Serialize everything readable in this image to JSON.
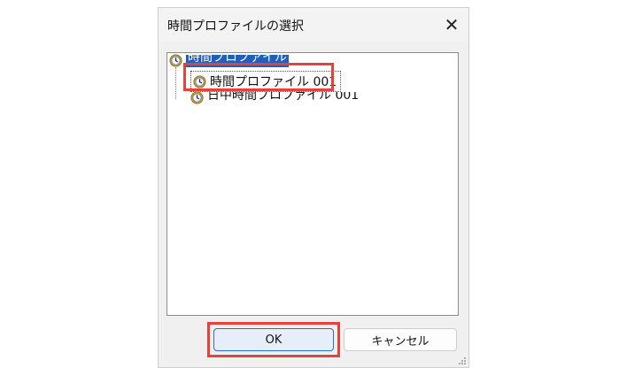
{
  "dialog": {
    "title": "時間プロファイルの選択",
    "close_symbol": "✕"
  },
  "tree": {
    "root_label": "時間プロファイル",
    "items": [
      {
        "label": "時間プロファイル 001"
      },
      {
        "label": "日中時間プロファイル 001"
      }
    ]
  },
  "buttons": {
    "ok_label": "OK",
    "cancel_label": "キャンセル"
  },
  "colors": {
    "highlight": "#e8403a",
    "selection": "#1f5fbf",
    "ok_border": "#2a6bd6"
  }
}
